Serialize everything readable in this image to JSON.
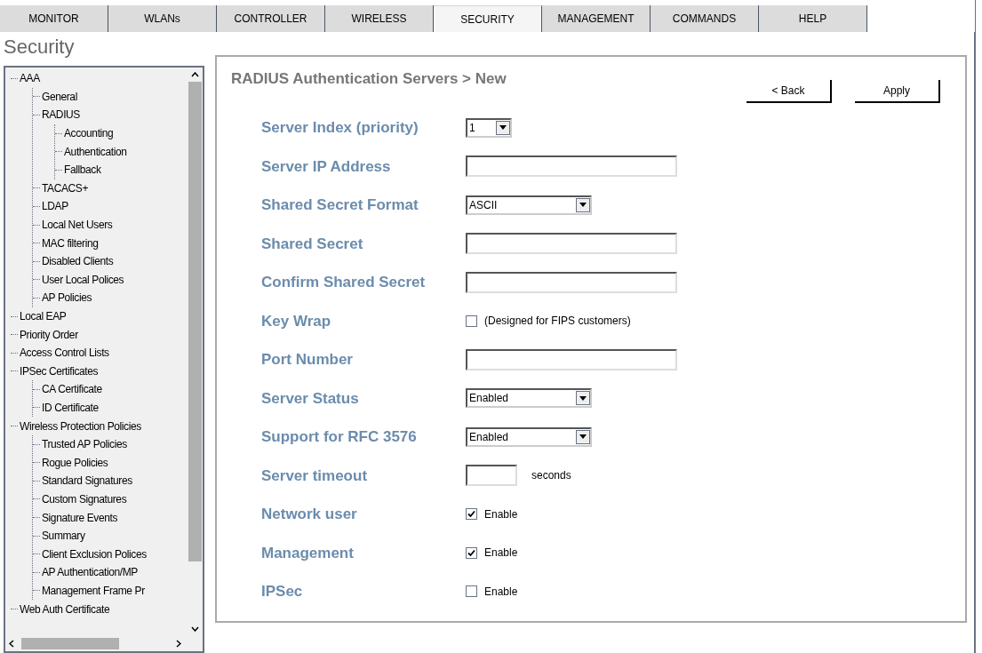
{
  "tabs": [
    {
      "label": "MONITOR",
      "selected": false
    },
    {
      "label": "WLANs",
      "selected": false
    },
    {
      "label": "CONTROLLER",
      "selected": false
    },
    {
      "label": "WIRELESS",
      "selected": false
    },
    {
      "label": "SECURITY",
      "selected": true
    },
    {
      "label": "MANAGEMENT",
      "selected": false
    },
    {
      "label": "COMMANDS",
      "selected": false
    },
    {
      "label": "HELP",
      "selected": false
    }
  ],
  "sidebar": {
    "title": "Security",
    "tree": [
      {
        "label": "AAA",
        "children": [
          {
            "label": "General"
          },
          {
            "label": "RADIUS",
            "children": [
              {
                "label": "Accounting"
              },
              {
                "label": "Authentication"
              },
              {
                "label": "Fallback"
              }
            ]
          },
          {
            "label": "TACACS+"
          },
          {
            "label": "LDAP"
          },
          {
            "label": "Local Net Users"
          },
          {
            "label": "MAC filtering"
          },
          {
            "label": "Disabled Clients"
          },
          {
            "label": "User Local Polices"
          },
          {
            "label": "AP Policies"
          }
        ]
      },
      {
        "label": "Local EAP"
      },
      {
        "label": "Priority Order"
      },
      {
        "label": "Access Control Lists"
      },
      {
        "label": "IPSec Certificates",
        "children": [
          {
            "label": "CA Certificate"
          },
          {
            "label": "ID Certificate"
          }
        ]
      },
      {
        "label": "Wireless Protection Policies",
        "children": [
          {
            "label": "Trusted AP Policies"
          },
          {
            "label": "Rogue Policies"
          },
          {
            "label": "Standard Signatures"
          },
          {
            "label": "Custom Signatures"
          },
          {
            "label": "Signature Events"
          },
          {
            "label": "Summary"
          },
          {
            "label": "Client Exclusion Polices"
          },
          {
            "label": "AP Authentication/MP"
          },
          {
            "label": "Management Frame Pr"
          }
        ]
      },
      {
        "label": "Web Auth Certificate"
      }
    ]
  },
  "panel": {
    "title": "RADIUS Authentication Servers > New",
    "buttons": [
      "< Back",
      "Apply"
    ],
    "rows": [
      {
        "kind": "small_select",
        "label": "Server Index (priority)",
        "value": "1"
      },
      {
        "kind": "text",
        "label": "Server IP Address"
      },
      {
        "kind": "select",
        "label": "Shared Secret Format",
        "value": "ASCII"
      },
      {
        "kind": "text",
        "label": "Shared Secret"
      },
      {
        "kind": "text",
        "label": "Confirm Shared Secret"
      },
      {
        "kind": "checkbox",
        "label": "Key Wrap",
        "checked": false,
        "text": "(Designed for FIPS customers)"
      },
      {
        "kind": "text",
        "label": "Port Number"
      },
      {
        "kind": "select",
        "label": "Server Status",
        "value": "Enabled"
      },
      {
        "kind": "select",
        "label": "Support for RFC 3576",
        "value": "Enabled"
      },
      {
        "kind": "short_text",
        "label": "Server timeout",
        "suffix": "seconds"
      },
      {
        "kind": "checkbox",
        "label": "Network user",
        "checked": true,
        "text": "Enable"
      },
      {
        "kind": "checkbox",
        "label": "Management",
        "checked": true,
        "text": "Enable"
      },
      {
        "kind": "checkbox",
        "label": "IPSec",
        "checked": false,
        "text": "Enable"
      }
    ]
  }
}
